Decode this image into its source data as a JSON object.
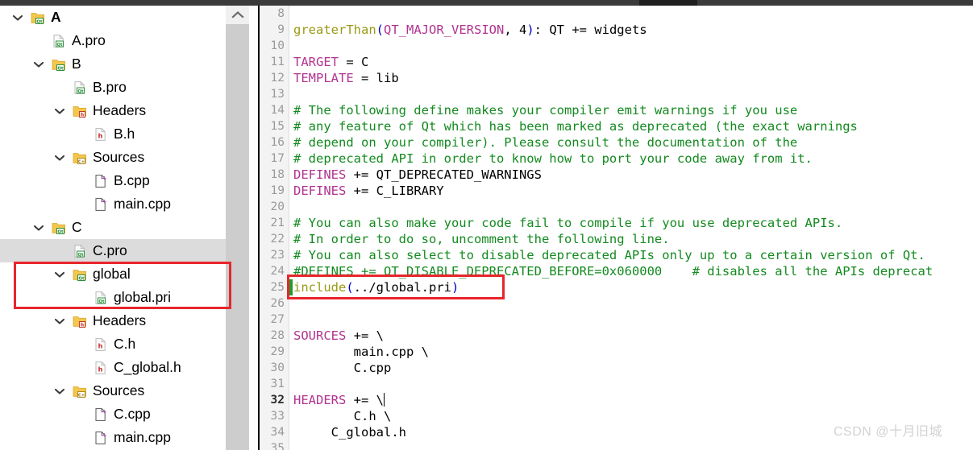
{
  "window": {
    "watermark": "CSDN @十月旧城"
  },
  "tree": {
    "name": "project-tree",
    "items": [
      {
        "label": "A",
        "indent": 0,
        "chevron": "down",
        "icon": "folder-qt-icon",
        "bold": true,
        "selected": false
      },
      {
        "label": "A.pro",
        "indent": 1,
        "chevron": "none",
        "icon": "file-qt-icon",
        "bold": false,
        "selected": false
      },
      {
        "label": "B",
        "indent": 1,
        "chevron": "down",
        "icon": "folder-qt-icon",
        "bold": false,
        "selected": false
      },
      {
        "label": "B.pro",
        "indent": 2,
        "chevron": "none",
        "icon": "file-qt-icon",
        "bold": false,
        "selected": false
      },
      {
        "label": "Headers",
        "indent": 2,
        "chevron": "down",
        "icon": "folder-h-icon",
        "bold": false,
        "selected": false
      },
      {
        "label": "B.h",
        "indent": 3,
        "chevron": "none",
        "icon": "file-h-icon",
        "bold": false,
        "selected": false
      },
      {
        "label": "Sources",
        "indent": 2,
        "chevron": "down",
        "icon": "folder-cpp-icon",
        "bold": false,
        "selected": false
      },
      {
        "label": "B.cpp",
        "indent": 3,
        "chevron": "none",
        "icon": "file-cpp-icon",
        "bold": false,
        "selected": false
      },
      {
        "label": "main.cpp",
        "indent": 3,
        "chevron": "none",
        "icon": "file-cpp-icon",
        "bold": false,
        "selected": false
      },
      {
        "label": "C",
        "indent": 1,
        "chevron": "down",
        "icon": "folder-qt-icon",
        "bold": false,
        "selected": false
      },
      {
        "label": "C.pro",
        "indent": 2,
        "chevron": "none",
        "icon": "file-qt-icon",
        "bold": false,
        "selected": true
      },
      {
        "label": "global",
        "indent": 2,
        "chevron": "down",
        "icon": "folder-qt-icon",
        "bold": false,
        "selected": false
      },
      {
        "label": "global.pri",
        "indent": 3,
        "chevron": "none",
        "icon": "file-qt-icon",
        "bold": false,
        "selected": false
      },
      {
        "label": "Headers",
        "indent": 2,
        "chevron": "down",
        "icon": "folder-h-icon",
        "bold": false,
        "selected": false
      },
      {
        "label": "C.h",
        "indent": 3,
        "chevron": "none",
        "icon": "file-h-icon",
        "bold": false,
        "selected": false
      },
      {
        "label": "C_global.h",
        "indent": 3,
        "chevron": "none",
        "icon": "file-h-icon",
        "bold": false,
        "selected": false
      },
      {
        "label": "Sources",
        "indent": 2,
        "chevron": "down",
        "icon": "folder-cpp-icon",
        "bold": false,
        "selected": false
      },
      {
        "label": "C.cpp",
        "indent": 3,
        "chevron": "none",
        "icon": "file-cpp-icon",
        "bold": false,
        "selected": false
      },
      {
        "label": "main.cpp",
        "indent": 3,
        "chevron": "none",
        "icon": "file-cpp-icon",
        "bold": false,
        "selected": false
      }
    ]
  },
  "scrollbar": {
    "up_arrow_icon": "chevron-up-icon"
  },
  "editor": {
    "name": "qmake-pro-editor",
    "first_line": 8,
    "cursor_line": 32,
    "modified_lines": [
      25
    ],
    "lines": [
      {
        "n": 8,
        "tokens": []
      },
      {
        "n": 9,
        "tokens": [
          {
            "t": "greaterThan",
            "c": "fn"
          },
          {
            "t": "(",
            "c": "punc"
          },
          {
            "t": "QT_MAJOR_VERSION",
            "c": "var"
          },
          {
            "t": ", 4",
            "c": "plain"
          },
          {
            "t": ")",
            "c": "punc"
          },
          {
            "t": ": QT += widgets",
            "c": "plain"
          }
        ]
      },
      {
        "n": 10,
        "tokens": []
      },
      {
        "n": 11,
        "tokens": [
          {
            "t": "TARGET",
            "c": "kw"
          },
          {
            "t": " = C",
            "c": "plain"
          }
        ]
      },
      {
        "n": 12,
        "tokens": [
          {
            "t": "TEMPLATE",
            "c": "kw"
          },
          {
            "t": " = lib",
            "c": "plain"
          }
        ]
      },
      {
        "n": 13,
        "tokens": []
      },
      {
        "n": 14,
        "tokens": [
          {
            "t": "# The following define makes your compiler emit warnings if you use",
            "c": "cmt"
          }
        ]
      },
      {
        "n": 15,
        "tokens": [
          {
            "t": "# any feature of Qt which has been marked as deprecated (the exact warnings",
            "c": "cmt"
          }
        ]
      },
      {
        "n": 16,
        "tokens": [
          {
            "t": "# depend on your compiler). Please consult the documentation of the",
            "c": "cmt"
          }
        ]
      },
      {
        "n": 17,
        "tokens": [
          {
            "t": "# deprecated API in order to know how to port your code away from it.",
            "c": "cmt"
          }
        ]
      },
      {
        "n": 18,
        "tokens": [
          {
            "t": "DEFINES",
            "c": "kw"
          },
          {
            "t": " += QT_DEPRECATED_WARNINGS",
            "c": "plain"
          }
        ]
      },
      {
        "n": 19,
        "tokens": [
          {
            "t": "DEFINES",
            "c": "kw"
          },
          {
            "t": " += C_LIBRARY",
            "c": "plain"
          }
        ]
      },
      {
        "n": 20,
        "tokens": []
      },
      {
        "n": 21,
        "tokens": [
          {
            "t": "# You can also make your code fail to compile if you use deprecated APIs.",
            "c": "cmt"
          }
        ]
      },
      {
        "n": 22,
        "tokens": [
          {
            "t": "# In order to do so, uncomment the following line.",
            "c": "cmt"
          }
        ]
      },
      {
        "n": 23,
        "tokens": [
          {
            "t": "# You can also select to disable deprecated APIs only up to a certain version of Qt.",
            "c": "cmt"
          }
        ]
      },
      {
        "n": 24,
        "tokens": [
          {
            "t": "#DEFINES += QT_DISABLE_DEPRECATED_BEFORE=0x060000    # disables all the APIs deprecat",
            "c": "cmt"
          }
        ]
      },
      {
        "n": 25,
        "tokens": [
          {
            "t": "include",
            "c": "fn"
          },
          {
            "t": "(",
            "c": "punc"
          },
          {
            "t": "../global.pri",
            "c": "plain"
          },
          {
            "t": ")",
            "c": "punc"
          }
        ]
      },
      {
        "n": 26,
        "tokens": []
      },
      {
        "n": 27,
        "tokens": []
      },
      {
        "n": 28,
        "tokens": [
          {
            "t": "SOURCES",
            "c": "kw"
          },
          {
            "t": " += \\",
            "c": "plain"
          }
        ]
      },
      {
        "n": 29,
        "tokens": [
          {
            "t": "        main.cpp \\",
            "c": "plain"
          }
        ]
      },
      {
        "n": 30,
        "tokens": [
          {
            "t": "        C.cpp",
            "c": "plain"
          }
        ]
      },
      {
        "n": 31,
        "tokens": []
      },
      {
        "n": 32,
        "tokens": [
          {
            "t": "HEADERS",
            "c": "kw"
          },
          {
            "t": " += \\",
            "c": "plain"
          }
        ]
      },
      {
        "n": 33,
        "tokens": [
          {
            "t": "        C.h \\",
            "c": "plain"
          }
        ]
      },
      {
        "n": 34,
        "tokens": [
          {
            "t": "     C_global.h",
            "c": "plain"
          }
        ]
      },
      {
        "n": 35,
        "tokens": []
      }
    ]
  },
  "annotations": [
    {
      "name": "redbox-tree",
      "target": "global folder and global.pri",
      "color": "#e8262c"
    },
    {
      "name": "redbox-include",
      "target": "include(../global.pri)",
      "color": "#e8262c"
    }
  ]
}
